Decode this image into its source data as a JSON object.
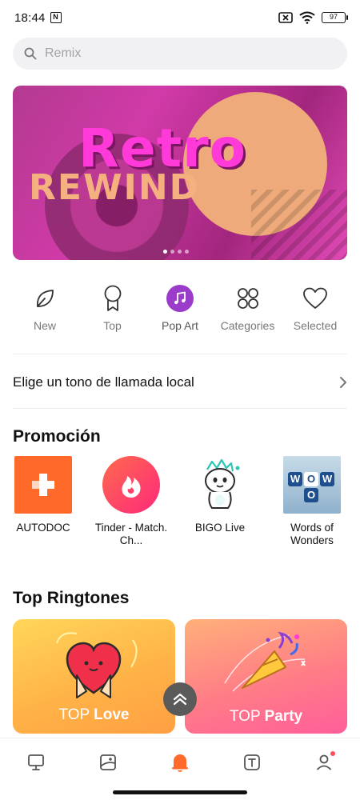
{
  "status_bar": {
    "time": "18:44",
    "nfc": "N",
    "battery": "97"
  },
  "search": {
    "placeholder": "Remix"
  },
  "banner": {
    "title_line1": "Retro",
    "title_line2": "REWIND",
    "page_count": 4,
    "active_page": 1
  },
  "categories": [
    {
      "label": "New",
      "icon": "leaf-icon"
    },
    {
      "label": "Top",
      "icon": "medal-icon"
    },
    {
      "label": "Pop Art",
      "icon": "music-note-icon"
    },
    {
      "label": "Categories",
      "icon": "four-petal-icon"
    },
    {
      "label": "Selected",
      "icon": "heart-icon"
    }
  ],
  "local_ringtone": {
    "label": "Elige un tono de llamada local"
  },
  "promotion": {
    "title": "Promoción",
    "apps": [
      {
        "name": "AUTODOC"
      },
      {
        "name": "Tinder - Match. Ch..."
      },
      {
        "name": "BIGO Live"
      },
      {
        "name": "Words of Wonders"
      }
    ],
    "words_tiles": [
      "W",
      "O",
      "W",
      "O"
    ]
  },
  "top_ringtones": {
    "title": "Top Ringtones",
    "cards": [
      {
        "prefix": "TOP",
        "name": "Love"
      },
      {
        "prefix": "TOP",
        "name": "Party"
      }
    ]
  },
  "colors": {
    "accent_orange": "#ff6a2a",
    "pop_art_purple": "#9a3bc9",
    "notification_dot": "#ff4d5a"
  }
}
